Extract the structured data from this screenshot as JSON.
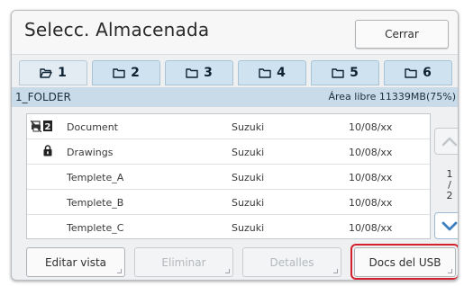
{
  "dialog": {
    "title": "Selecc. Almacenada",
    "close_label": "Cerrar"
  },
  "tabs": [
    {
      "label": "1",
      "active": true
    },
    {
      "label": "2",
      "active": false
    },
    {
      "label": "3",
      "active": false
    },
    {
      "label": "4",
      "active": false
    },
    {
      "label": "5",
      "active": false
    },
    {
      "label": "6",
      "active": false
    }
  ],
  "folder": {
    "name": "1_FOLDER",
    "free_space": "Área libre 11339MB(75%)"
  },
  "files": [
    {
      "name": "Document",
      "owner": "Suzuki",
      "date": "10/08/xx",
      "icons": [
        "no-print-icon",
        "badge-2-icon"
      ]
    },
    {
      "name": "Drawings",
      "owner": "Suzuki",
      "date": "10/08/xx",
      "icons": [
        "lock-icon"
      ]
    },
    {
      "name": "Templete_A",
      "owner": "Suzuki",
      "date": "10/08/xx",
      "icons": []
    },
    {
      "name": "Templete_B",
      "owner": "Suzuki",
      "date": "10/08/xx",
      "icons": []
    },
    {
      "name": "Templete_C",
      "owner": "Suzuki",
      "date": "10/08/xx",
      "icons": []
    }
  ],
  "pagination": {
    "current": "1",
    "separator": "/",
    "total": "2"
  },
  "buttons": {
    "edit_view": "Editar vista",
    "delete": "Eliminar",
    "details": "Detalles",
    "usb_docs": "Docs del USB"
  },
  "colors": {
    "tab_fill": "#cfe2ef",
    "folder_bar": "#c9dbe8",
    "highlight": "#d4202d",
    "scroll_arrow": "#3c7fc1"
  }
}
